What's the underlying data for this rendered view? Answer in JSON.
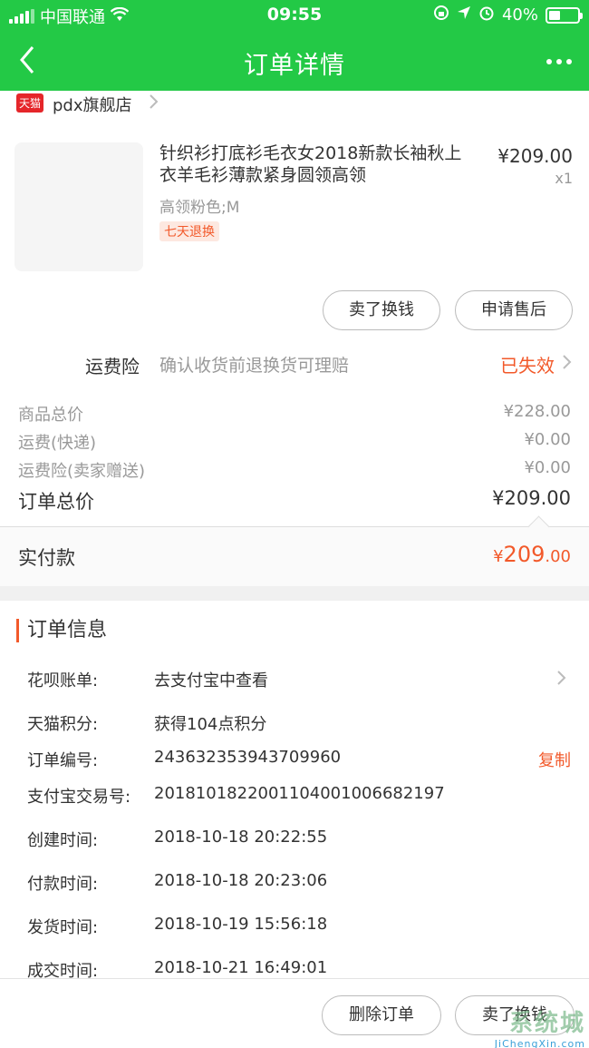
{
  "status_bar": {
    "carrier": "中国联通",
    "time": "09:55",
    "battery": "40%",
    "battery_level": 0.4
  },
  "nav": {
    "title": "订单详情"
  },
  "shop": {
    "badge": "天猫",
    "name": "pdx旗舰店"
  },
  "product": {
    "title": "针织衫打底衫毛衣女2018新款长袖秋上衣羊毛衫薄款紧身圆领高领",
    "spec": "高领粉色;M",
    "tag": "七天退换",
    "price": "¥209.00",
    "qty": "x1",
    "buttons": {
      "sell": "卖了换钱",
      "after_sale": "申请售后"
    }
  },
  "insurance": {
    "label": "运费险",
    "desc": "确认收货前退换货可理赔",
    "status": "已失效"
  },
  "summary": {
    "items_label": "商品总价",
    "items_value": "¥228.00",
    "shipping_label": "运费(快递)",
    "shipping_value": "¥0.00",
    "ins_label": "运费险(卖家赠送)",
    "ins_value": "¥0.00",
    "total_label": "订单总价",
    "total_value": "¥209.00"
  },
  "paid": {
    "label": "实付款",
    "currency": "¥",
    "integer": "209",
    "decimal": ".00"
  },
  "order_info": {
    "title": "订单信息",
    "rows": [
      {
        "key": "花呗账单:",
        "value": "去支付宝中查看"
      },
      {
        "key": "天猫积分:",
        "value": "获得104点积分"
      },
      {
        "key": "订单编号:",
        "value": "243632353943709960",
        "action": "复制"
      },
      {
        "key": "支付宝交易号:",
        "value": "2018101822001104001006682197"
      },
      {
        "key": "创建时间:",
        "value": "2018-10-18 20:22:55"
      },
      {
        "key": "付款时间:",
        "value": "2018-10-18 20:23:06"
      },
      {
        "key": "发货时间:",
        "value": "2018-10-19 15:56:18"
      },
      {
        "key": "成交时间:",
        "value": "2018-10-21 16:49:01"
      }
    ]
  },
  "bottom": {
    "delete": "删除订单",
    "sell": "卖了换钱"
  },
  "watermark": {
    "main": "系统城",
    "sub": "JiChengXin.com"
  },
  "colors": {
    "brand_green": "#23c946",
    "accent_orange": "#f2592a",
    "tmall_red": "#e5262a"
  }
}
